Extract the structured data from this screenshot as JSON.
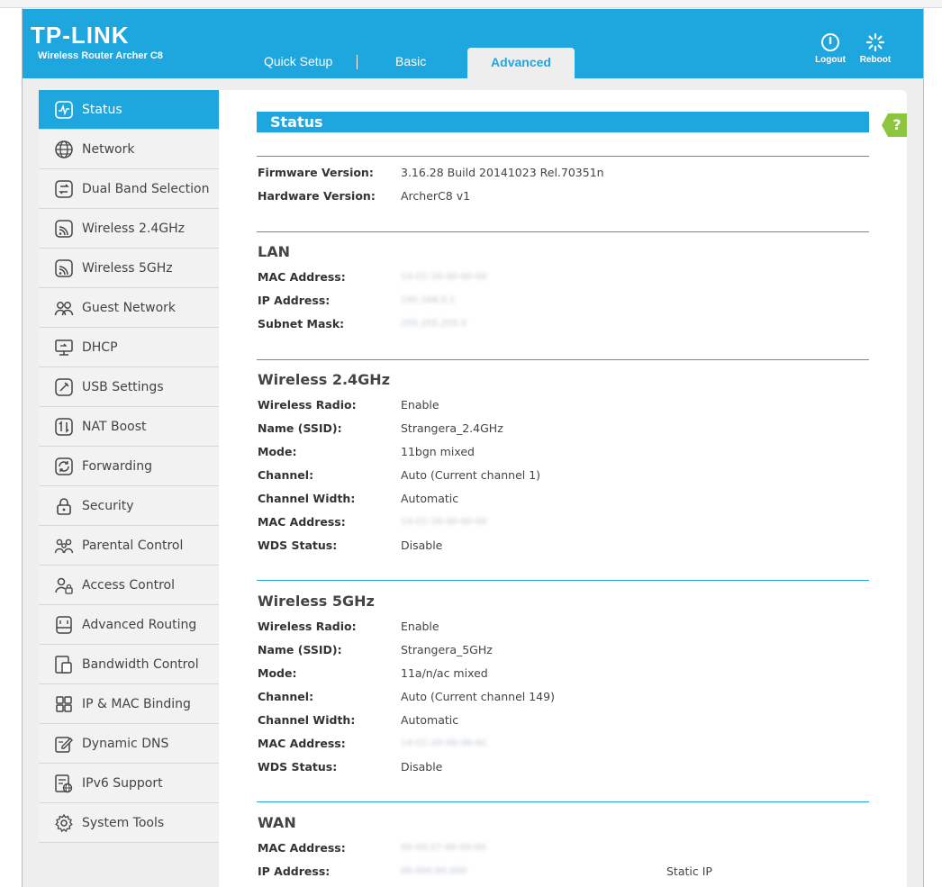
{
  "brand": {
    "logo": "TP-LINK",
    "model": "Wireless Router Archer C8"
  },
  "tabs": {
    "quick_setup": "Quick Setup",
    "basic": "Basic",
    "advanced": "Advanced"
  },
  "header_actions": {
    "logout": "Logout",
    "reboot": "Reboot"
  },
  "sidebar": {
    "items": [
      {
        "label": "Status",
        "icon": "status-icon",
        "active": true
      },
      {
        "label": "Network",
        "icon": "globe-icon"
      },
      {
        "label": "Dual Band Selection",
        "icon": "dual-band-icon"
      },
      {
        "label": "Wireless 2.4GHz",
        "icon": "wireless-icon"
      },
      {
        "label": "Wireless 5GHz",
        "icon": "wireless-icon"
      },
      {
        "label": "Guest Network",
        "icon": "guest-users-icon"
      },
      {
        "label": "DHCP",
        "icon": "monitor-icon"
      },
      {
        "label": "USB Settings",
        "icon": "usb-icon"
      },
      {
        "label": "NAT Boost",
        "icon": "nat-boost-icon"
      },
      {
        "label": "Forwarding",
        "icon": "forwarding-icon"
      },
      {
        "label": "Security",
        "icon": "lock-icon"
      },
      {
        "label": "Parental Control",
        "icon": "family-icon"
      },
      {
        "label": "Access Control",
        "icon": "user-lock-icon"
      },
      {
        "label": "Advanced Routing",
        "icon": "router-icon"
      },
      {
        "label": "Bandwidth Control",
        "icon": "bandwidth-icon"
      },
      {
        "label": "IP & MAC Binding",
        "icon": "binding-icon"
      },
      {
        "label": "Dynamic DNS",
        "icon": "edit-icon"
      },
      {
        "label": "IPv6 Support",
        "icon": "ipv6-icon"
      },
      {
        "label": "System Tools",
        "icon": "gear-icon"
      }
    ]
  },
  "page": {
    "title": "Status",
    "help": "?"
  },
  "firmware": {
    "firmware_label": "Firmware Version:",
    "firmware_value": "3.16.28 Build 20141023 Rel.70351n",
    "hardware_label": "Hardware Version:",
    "hardware_value": "ArcherC8 v1"
  },
  "lan": {
    "title": "LAN",
    "rows": [
      {
        "label": "MAC Address:",
        "value": "14-CC-20-00-00-00"
      },
      {
        "label": "IP Address:",
        "value": "192.168.0.1"
      },
      {
        "label": "Subnet Mask:",
        "value": "255.255.255.0"
      }
    ]
  },
  "wireless24": {
    "title": "Wireless 2.4GHz",
    "rows": [
      {
        "label": "Wireless Radio:",
        "value": "Enable"
      },
      {
        "label": "Name (SSID):",
        "value": "Strangera_2.4GHz"
      },
      {
        "label": "Mode:",
        "value": "11bgn mixed"
      },
      {
        "label": "Channel:",
        "value": "Auto (Current channel 1)"
      },
      {
        "label": "Channel Width:",
        "value": "Automatic"
      },
      {
        "label": "MAC Address:",
        "value": "14-CC-20-00-00-00"
      },
      {
        "label": "WDS Status:",
        "value": "Disable"
      }
    ]
  },
  "wireless5": {
    "title": "Wireless 5GHz",
    "rows": [
      {
        "label": "Wireless Radio:",
        "value": "Enable"
      },
      {
        "label": "Name (SSID):",
        "value": "Strangera_5GHz"
      },
      {
        "label": "Mode:",
        "value": "11a/n/ac mixed"
      },
      {
        "label": "Channel:",
        "value": "Auto (Current channel 149)"
      },
      {
        "label": "Channel Width:",
        "value": "Automatic"
      },
      {
        "label": "MAC Address:",
        "value": "14-CC-20-00-00-0C"
      },
      {
        "label": "WDS Status:",
        "value": "Disable"
      }
    ]
  },
  "wan": {
    "title": "WAN",
    "rows": [
      {
        "label": "MAC Address:",
        "value": "00-00-27-00-00-00"
      },
      {
        "label": "IP Address:",
        "value": "00.000.00.000",
        "extra": "Static IP"
      }
    ]
  },
  "colors": {
    "accent": "#1ea7df",
    "help": "#8cc63f",
    "sidebar_bg": "#f2f2f2",
    "frame_bg": "#eeeeee"
  }
}
